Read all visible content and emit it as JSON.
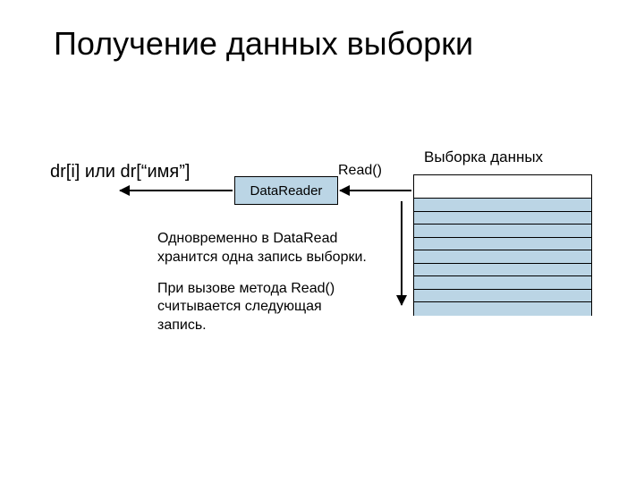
{
  "title": "Получение данных выборки",
  "access_label": "dr[i] или dr[“имя”]",
  "box_label": "DataReader",
  "read_label": "Read()",
  "table_label": "Выборка данных",
  "note_p1": "Одновременно в DataRead хранится одна запись выборки.",
  "note_p2": "При вызове метода Read() считывается следующая запись."
}
